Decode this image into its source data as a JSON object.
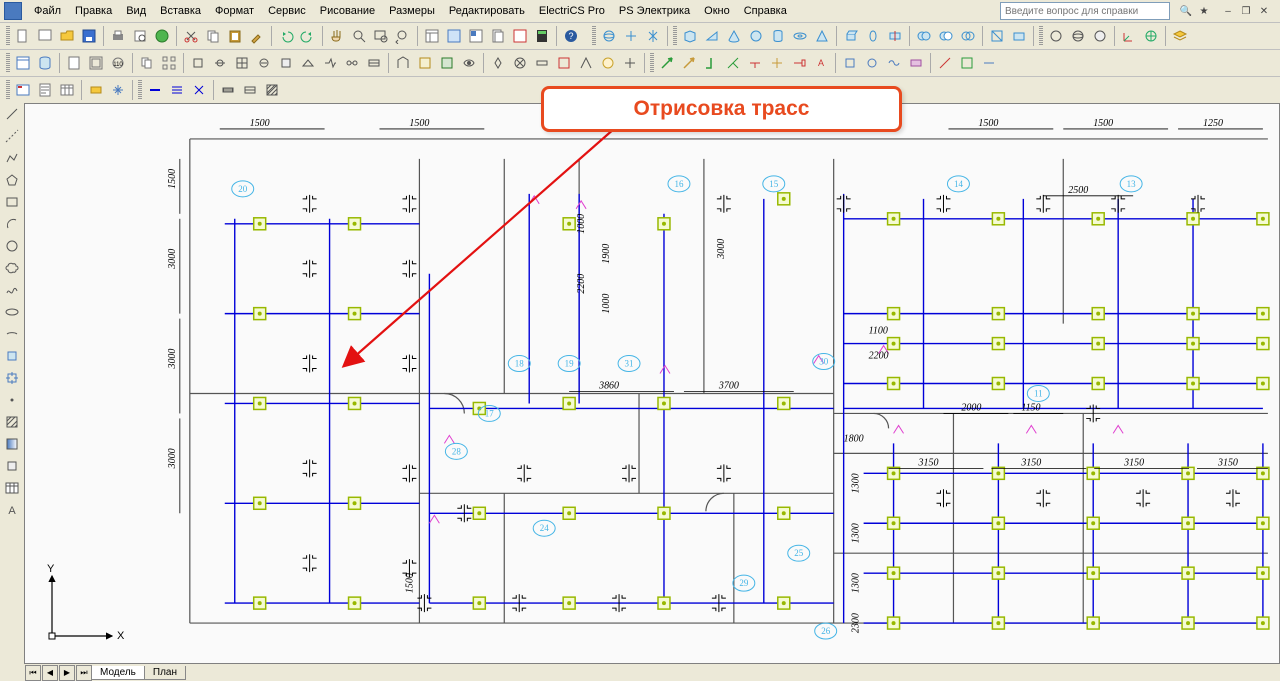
{
  "menu": {
    "items": [
      "Файл",
      "Правка",
      "Вид",
      "Вставка",
      "Формат",
      "Сервис",
      "Рисование",
      "Размеры",
      "Редактировать",
      "ElectriCS Pro",
      "PS Электрика",
      "Окно",
      "Справка"
    ]
  },
  "help_placeholder": "Введите вопрос для справки",
  "callout": {
    "text": "Отрисовка трасс"
  },
  "tabs": {
    "model": "Модель",
    "sheets": [
      "План"
    ]
  },
  "ucs": {
    "x": "X",
    "y": "Y"
  },
  "dimensions": {
    "top": [
      "1500",
      "1500",
      "1500",
      "1500",
      "1250"
    ],
    "left": [
      "1500",
      "3000",
      "3000",
      "3000"
    ],
    "mid": [
      "1000",
      "1900",
      "2200",
      "1000",
      "3000",
      "1100",
      "2200",
      "3860",
      "3700",
      "1800",
      "2500",
      "2000",
      "1150"
    ],
    "right": [
      "3150",
      "3150",
      "3150",
      "3150",
      "1300",
      "1300",
      "1300",
      "2300",
      "1500"
    ]
  },
  "bubbles": [
    "20",
    "16",
    "15",
    "14",
    "13",
    "18",
    "19",
    "31",
    "30",
    "11",
    "17",
    "28",
    "24",
    "25",
    "29",
    "26"
  ]
}
